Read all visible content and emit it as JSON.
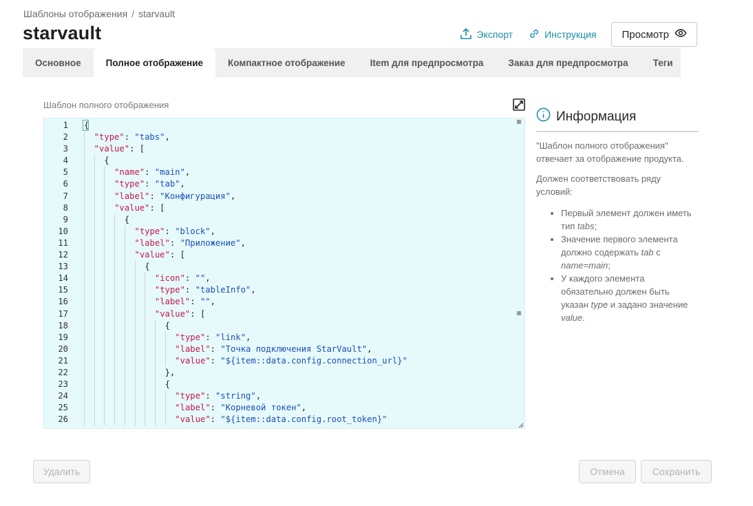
{
  "breadcrumb": {
    "parent": "Шаблоны отображения",
    "separator": "/",
    "current": "starvault"
  },
  "page_title": "starvault",
  "header": {
    "export_label": "Экспорт",
    "instructions_label": "Инструкция",
    "preview_label": "Просмотр"
  },
  "tabs": [
    {
      "label": "Основное",
      "active": false
    },
    {
      "label": "Полное отображение",
      "active": true
    },
    {
      "label": "Компактное отображение",
      "active": false
    },
    {
      "label": "Item для предпросмотра",
      "active": false
    },
    {
      "label": "Заказ для предпросмотра",
      "active": false
    },
    {
      "label": "Теги",
      "active": false
    }
  ],
  "editor": {
    "label": "Шаблон полного отображения",
    "lines": [
      {
        "n": "1",
        "indent": 0,
        "tokens": [
          [
            "p",
            "{"
          ]
        ]
      },
      {
        "n": "2",
        "indent": 1,
        "tokens": [
          [
            "k",
            "\"type\""
          ],
          [
            "p",
            ": "
          ],
          [
            "s",
            "\"tabs\""
          ],
          [
            "p",
            ","
          ]
        ]
      },
      {
        "n": "3",
        "indent": 1,
        "tokens": [
          [
            "k",
            "\"value\""
          ],
          [
            "p",
            ": ["
          ]
        ]
      },
      {
        "n": "4",
        "indent": 2,
        "tokens": [
          [
            "p",
            "{"
          ]
        ]
      },
      {
        "n": "5",
        "indent": 3,
        "tokens": [
          [
            "k",
            "\"name\""
          ],
          [
            "p",
            ": "
          ],
          [
            "s",
            "\"main\""
          ],
          [
            "p",
            ","
          ]
        ]
      },
      {
        "n": "6",
        "indent": 3,
        "tokens": [
          [
            "k",
            "\"type\""
          ],
          [
            "p",
            ": "
          ],
          [
            "s",
            "\"tab\""
          ],
          [
            "p",
            ","
          ]
        ]
      },
      {
        "n": "7",
        "indent": 3,
        "tokens": [
          [
            "k",
            "\"label\""
          ],
          [
            "p",
            ": "
          ],
          [
            "s",
            "\"Конфигурация\""
          ],
          [
            "p",
            ","
          ]
        ]
      },
      {
        "n": "8",
        "indent": 3,
        "tokens": [
          [
            "k",
            "\"value\""
          ],
          [
            "p",
            ": ["
          ]
        ]
      },
      {
        "n": "9",
        "indent": 4,
        "tokens": [
          [
            "p",
            "{"
          ]
        ]
      },
      {
        "n": "10",
        "indent": 5,
        "tokens": [
          [
            "k",
            "\"type\""
          ],
          [
            "p",
            ": "
          ],
          [
            "s",
            "\"block\""
          ],
          [
            "p",
            ","
          ]
        ]
      },
      {
        "n": "11",
        "indent": 5,
        "tokens": [
          [
            "k",
            "\"label\""
          ],
          [
            "p",
            ": "
          ],
          [
            "s",
            "\"Приложение\""
          ],
          [
            "p",
            ","
          ]
        ]
      },
      {
        "n": "12",
        "indent": 5,
        "tokens": [
          [
            "k",
            "\"value\""
          ],
          [
            "p",
            ": ["
          ]
        ]
      },
      {
        "n": "13",
        "indent": 6,
        "tokens": [
          [
            "p",
            "{"
          ]
        ]
      },
      {
        "n": "14",
        "indent": 7,
        "tokens": [
          [
            "k",
            "\"icon\""
          ],
          [
            "p",
            ": "
          ],
          [
            "s",
            "\"\""
          ],
          [
            "p",
            ","
          ]
        ]
      },
      {
        "n": "15",
        "indent": 7,
        "tokens": [
          [
            "k",
            "\"type\""
          ],
          [
            "p",
            ": "
          ],
          [
            "s",
            "\"tableInfo\""
          ],
          [
            "p",
            ","
          ]
        ]
      },
      {
        "n": "16",
        "indent": 7,
        "tokens": [
          [
            "k",
            "\"label\""
          ],
          [
            "p",
            ": "
          ],
          [
            "s",
            "\"\""
          ],
          [
            "p",
            ","
          ]
        ]
      },
      {
        "n": "17",
        "indent": 7,
        "tokens": [
          [
            "k",
            "\"value\""
          ],
          [
            "p",
            ": ["
          ]
        ]
      },
      {
        "n": "18",
        "indent": 8,
        "tokens": [
          [
            "p",
            "{"
          ]
        ]
      },
      {
        "n": "19",
        "indent": 9,
        "tokens": [
          [
            "k",
            "\"type\""
          ],
          [
            "p",
            ": "
          ],
          [
            "s",
            "\"link\""
          ],
          [
            "p",
            ","
          ]
        ]
      },
      {
        "n": "20",
        "indent": 9,
        "tokens": [
          [
            "k",
            "\"label\""
          ],
          [
            "p",
            ": "
          ],
          [
            "s",
            "\"Точка подключения StarVault\""
          ],
          [
            "p",
            ","
          ]
        ]
      },
      {
        "n": "21",
        "indent": 9,
        "tokens": [
          [
            "k",
            "\"value\""
          ],
          [
            "p",
            ": "
          ],
          [
            "s",
            "\"${item::data.config.connection_url}\""
          ]
        ]
      },
      {
        "n": "22",
        "indent": 8,
        "tokens": [
          [
            "p",
            "},"
          ]
        ]
      },
      {
        "n": "23",
        "indent": 8,
        "tokens": [
          [
            "p",
            "{"
          ]
        ]
      },
      {
        "n": "24",
        "indent": 9,
        "tokens": [
          [
            "k",
            "\"type\""
          ],
          [
            "p",
            ": "
          ],
          [
            "s",
            "\"string\""
          ],
          [
            "p",
            ","
          ]
        ]
      },
      {
        "n": "25",
        "indent": 9,
        "tokens": [
          [
            "k",
            "\"label\""
          ],
          [
            "p",
            ": "
          ],
          [
            "s",
            "\"Корневой токен\""
          ],
          [
            "p",
            ","
          ]
        ]
      },
      {
        "n": "26",
        "indent": 9,
        "tokens": [
          [
            "k",
            "\"value\""
          ],
          [
            "p",
            ": "
          ],
          [
            "s",
            "\"${item::data.config.root_token}\""
          ]
        ]
      }
    ]
  },
  "info": {
    "title": "Информация",
    "p1": "\"Шаблон полного отображения\" отвечает за отображение продукта.",
    "p2": "Должен соответствовать ряду условий:",
    "items": [
      [
        [
          "t",
          "Первый элемент должен иметь тип "
        ],
        [
          "i",
          "tabs"
        ],
        [
          "t",
          ";"
        ]
      ],
      [
        [
          "t",
          "Значение первого элемента должно содержать "
        ],
        [
          "i",
          "tab"
        ],
        [
          "t",
          " с "
        ],
        [
          "i",
          "name=main"
        ],
        [
          "t",
          ";"
        ]
      ],
      [
        [
          "t",
          "У каждого элемента обязательно должен быть указан "
        ],
        [
          "i",
          "type"
        ],
        [
          "t",
          " и задано значение "
        ],
        [
          "i",
          "value"
        ],
        [
          "t",
          "."
        ]
      ]
    ]
  },
  "footer": {
    "delete_label": "Удалить",
    "cancel_label": "Отмена",
    "save_label": "Сохранить"
  },
  "colors": {
    "accent": "#1a8fa8",
    "editor_bg": "#e6f9fb",
    "key": "#c4184a",
    "string": "#1b4fb8"
  }
}
